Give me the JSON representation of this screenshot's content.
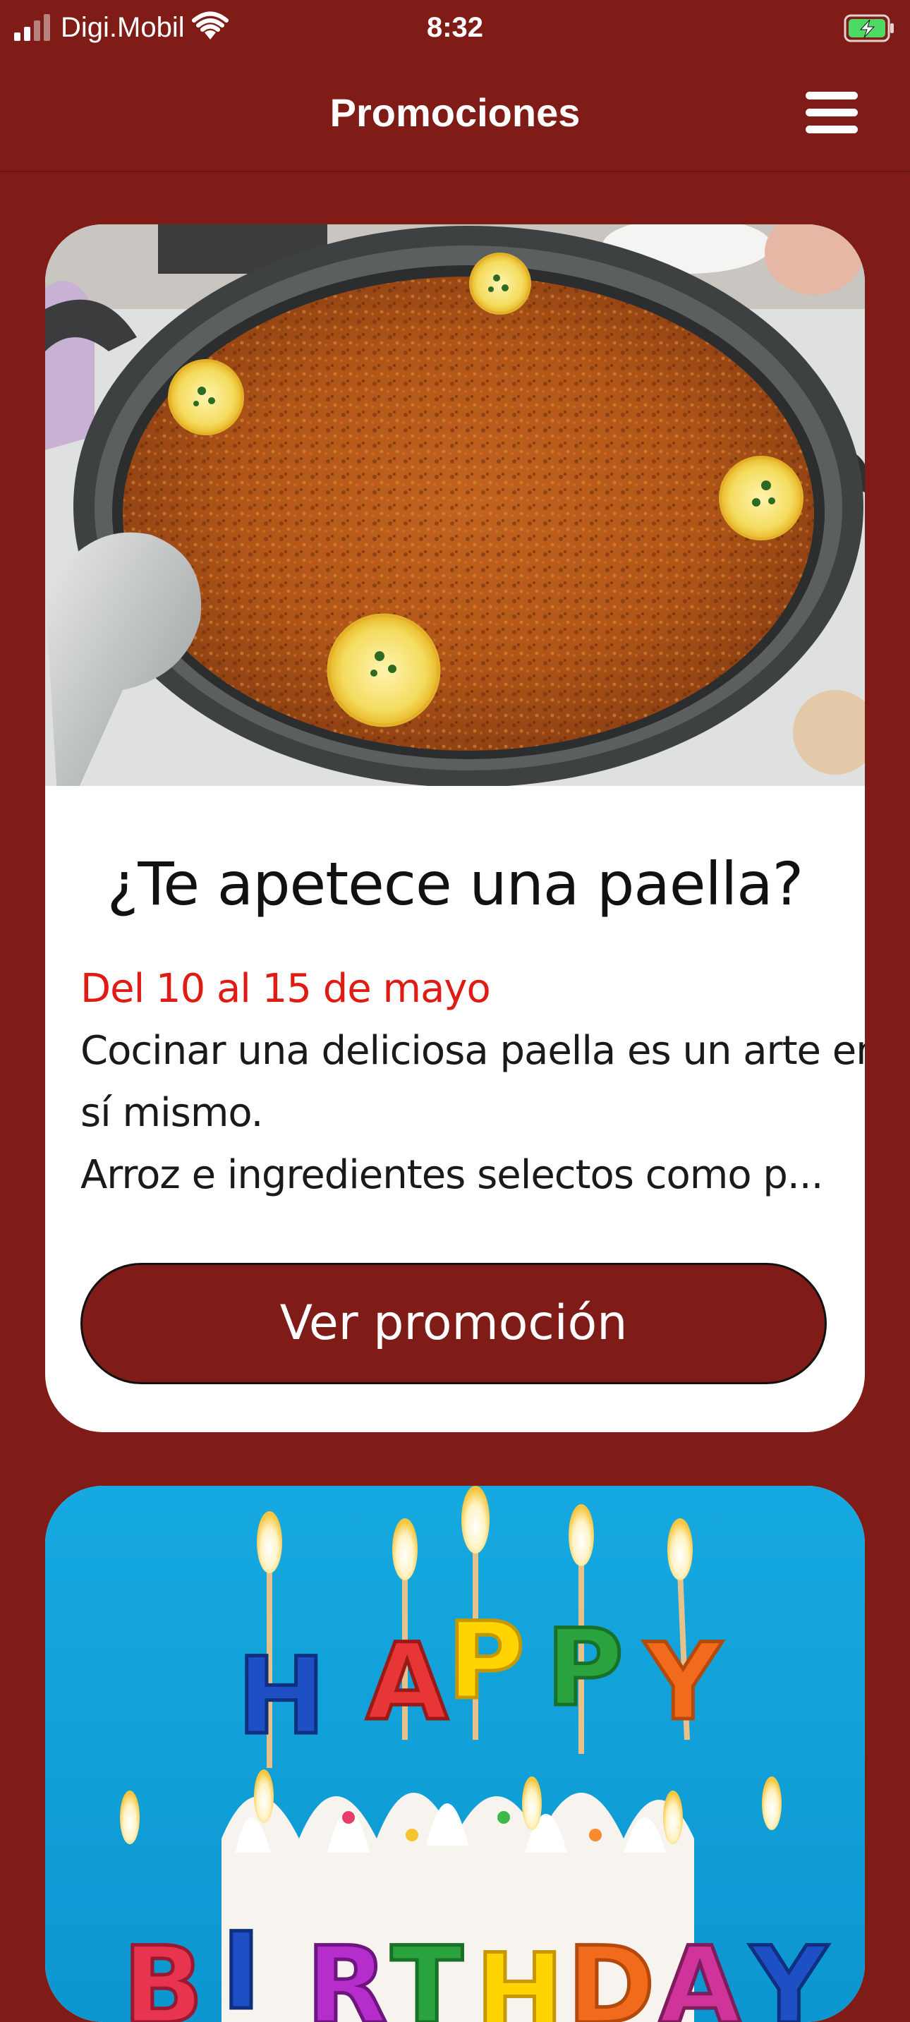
{
  "status_bar": {
    "carrier": "Digi.Mobil",
    "time": "8:32"
  },
  "header": {
    "title": "Promociones",
    "menu_icon": "hamburger-menu-icon"
  },
  "promotions": [
    {
      "image": "paella-photo",
      "title": "¿Te apetece una paella?",
      "dates": "Del 10 al 15 de mayo",
      "description_lines": [
        "Cocinar una deliciosa paella es un arte en",
        "sí mismo.",
        "Arroz e ingredientes selectos como p..."
      ],
      "button_label": "Ver promoción"
    },
    {
      "image": "birthday-cake-photo"
    }
  ],
  "colors": {
    "background": "#7f1c17",
    "card": "#ffffff",
    "dates": "#e01b14",
    "button": "#7f1c17"
  }
}
